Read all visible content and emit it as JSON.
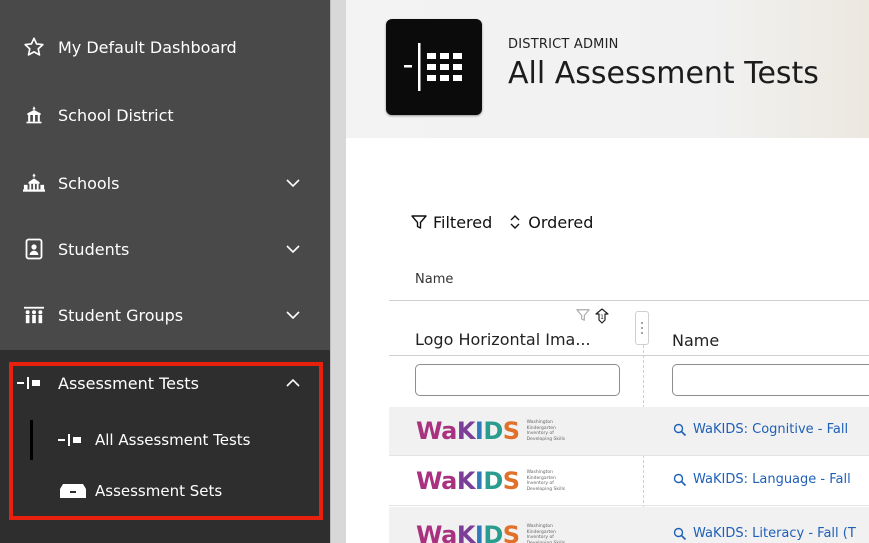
{
  "sidebar": {
    "items": [
      {
        "label": "My Default Dashboard",
        "icon": "star-icon",
        "has_chevron": false
      },
      {
        "label": "School District",
        "icon": "school-building-icon",
        "has_chevron": false
      },
      {
        "label": "Schools",
        "icon": "schools-icon",
        "has_chevron": true
      },
      {
        "label": "Students",
        "icon": "student-badge-icon",
        "has_chevron": true
      },
      {
        "label": "Student Groups",
        "icon": "group-icon",
        "has_chevron": true
      }
    ],
    "assessment": {
      "label": "Assessment Tests",
      "icon": "assessment-icon",
      "expanded": true,
      "sub_items": [
        {
          "label": "All Assessment Tests",
          "icon": "assessment-icon",
          "active": true
        },
        {
          "label": "Assessment Sets",
          "icon": "sets-icon",
          "active": false
        }
      ]
    },
    "highlight_color": "#e8210f"
  },
  "header": {
    "kicker": "DISTRICT ADMIN",
    "title": "All Assessment Tests"
  },
  "toolbar": {
    "filtered_label": "Filtered",
    "ordered_label": "Ordered"
  },
  "sort_label": "Name",
  "table": {
    "columns": [
      {
        "label": "Logo Horizontal Ima..."
      },
      {
        "label": "Name"
      }
    ],
    "filters": [
      {
        "value": "",
        "placeholder": ""
      },
      {
        "value": "",
        "placeholder": ""
      }
    ],
    "rows": [
      {
        "logo_text": "WaKIDS",
        "logo_tagline": "Washington Kindergarten Inventory of Developing Skills",
        "name": "WaKIDS: Cognitive - Fall"
      },
      {
        "logo_text": "WaKIDS",
        "logo_tagline": "Washington Kindergarten Inventory of Developing Skills",
        "name": "WaKIDS: Language - Fall"
      },
      {
        "logo_text": "WaKIDS",
        "logo_tagline": "Washington Kindergarten Inventory of Developing Skills",
        "name": "WaKIDS: Literacy - Fall (T"
      }
    ],
    "link_color": "#1e5fb8",
    "logo_colors": [
      "#a8327f",
      "#7b3f98",
      "#2f7ab8",
      "#2a9d8f",
      "#8cb43c",
      "#e0702a"
    ]
  }
}
